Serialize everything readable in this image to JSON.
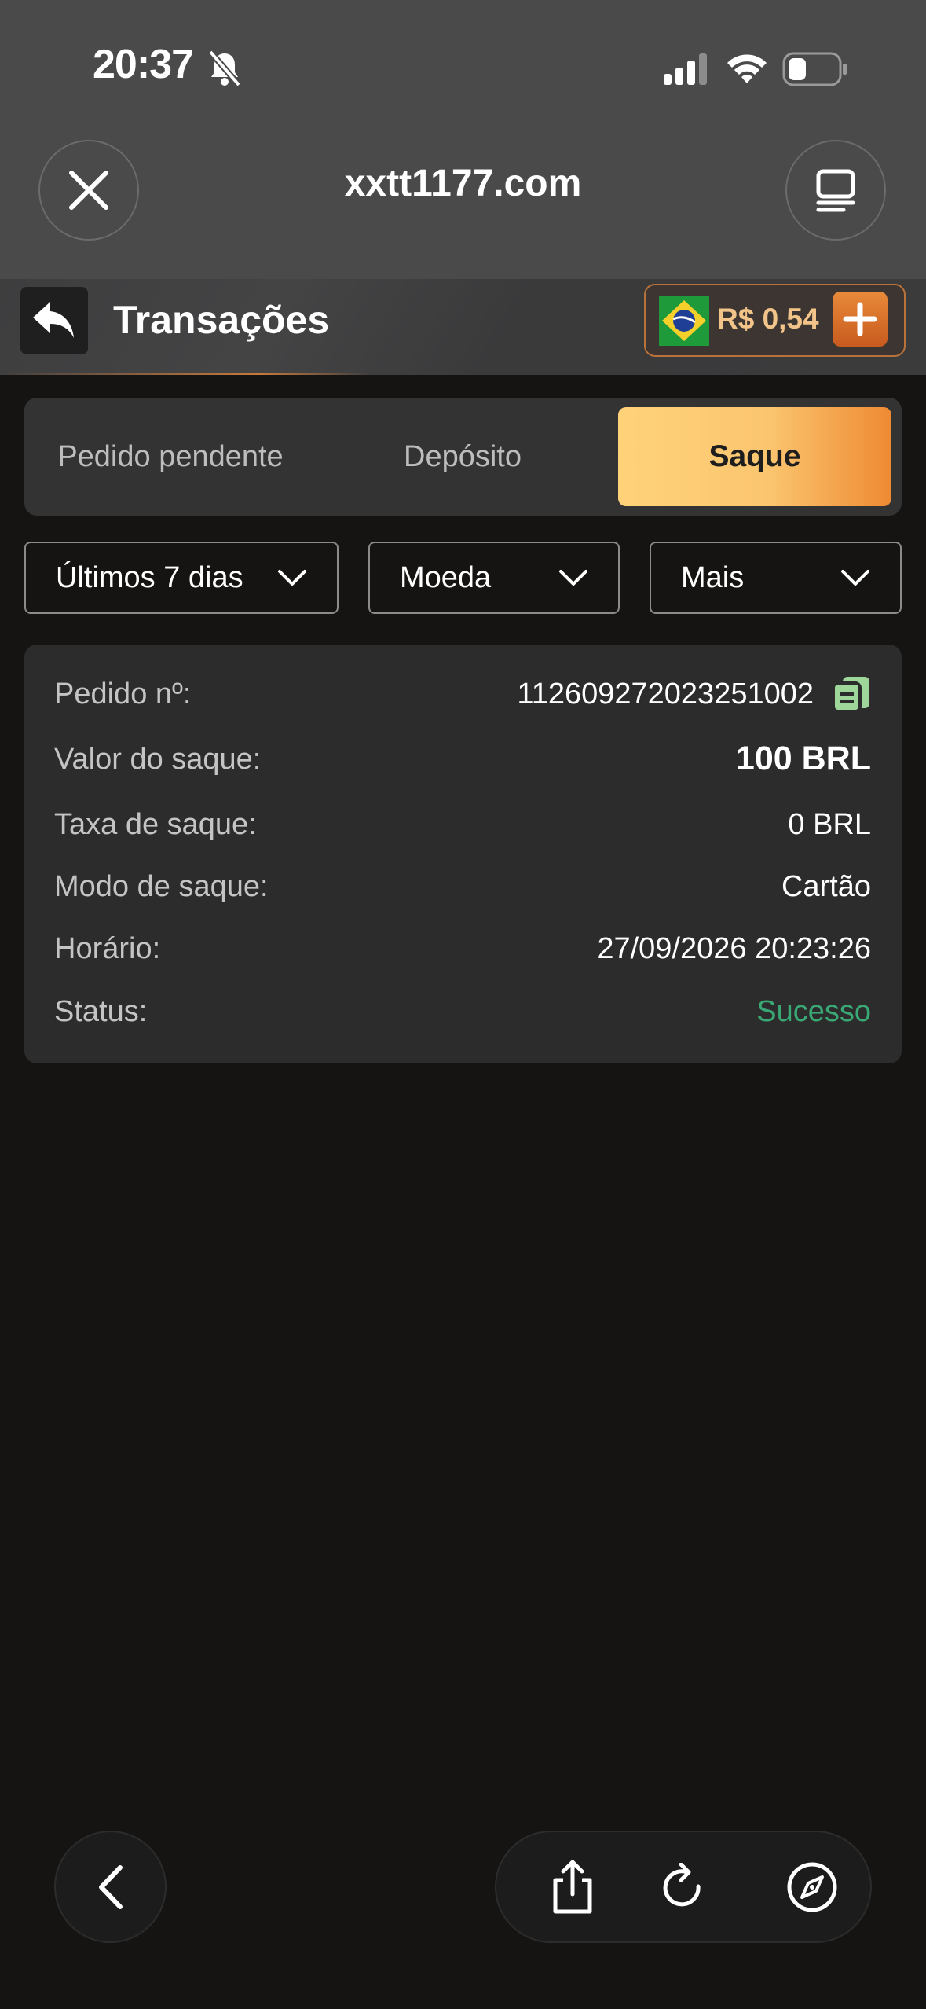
{
  "status_bar": {
    "time": "20:37"
  },
  "browser": {
    "url": "xxtt1177.com"
  },
  "header": {
    "title": "Transações",
    "balance": "R$ 0,54"
  },
  "tabs": [
    {
      "label": "Pedido pendente",
      "active": false
    },
    {
      "label": "Depósito",
      "active": false
    },
    {
      "label": "Saque",
      "active": true
    }
  ],
  "filters": {
    "period": "Últimos 7 dias",
    "currency": "Moeda",
    "more": "Mais"
  },
  "transaction": {
    "order_label": "Pedido nº:",
    "order_value": "112609272023251002",
    "amount_label": "Valor do saque:",
    "amount_value": "100 BRL",
    "fee_label": "Taxa de saque:",
    "fee_value": "0 BRL",
    "mode_label": "Modo de saque:",
    "mode_value": "Cartão",
    "time_label": "Horário:",
    "time_value": "27/09/2026 20:23:26",
    "status_label": "Status:",
    "status_value": "Sucesso"
  },
  "colors": {
    "accent": "#f0a24a",
    "success": "#3aa874",
    "copy_icon": "#9fd79a"
  },
  "icons": [
    "bell-slash-icon",
    "signal-icon",
    "wifi-icon",
    "battery-icon",
    "close-icon",
    "tabs-icon",
    "back-arrow-icon",
    "brazil-flag-icon",
    "plus-icon",
    "chevron-down-icon",
    "copy-icon",
    "chevron-left-icon",
    "share-icon",
    "reload-icon",
    "compass-icon"
  ]
}
